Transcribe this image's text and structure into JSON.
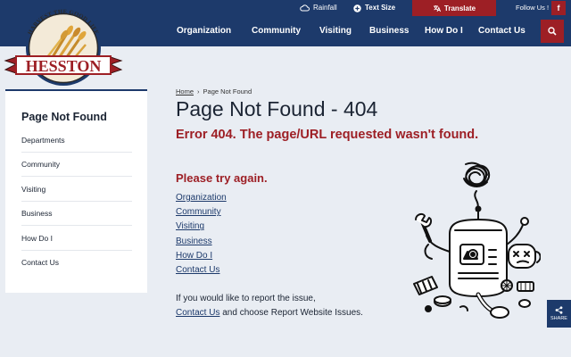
{
  "utility": {
    "rainfall": "Rainfall",
    "text_size": "Text Size",
    "translate": "Translate",
    "follow_us": "Follow Us !",
    "facebook_glyph": "f"
  },
  "logo": {
    "arc_text": "HARVEST THE GOOD LIFE",
    "banner_text": "HESSTON"
  },
  "nav": [
    "Organization",
    "Community",
    "Visiting",
    "Business",
    "How Do I",
    "Contact Us"
  ],
  "sidebar": {
    "title": "Page Not Found",
    "items": [
      "Departments",
      "Community",
      "Visiting",
      "Business",
      "How Do I",
      "Contact Us"
    ]
  },
  "breadcrumb": {
    "home": "Home",
    "separator": "›",
    "current": "Page Not Found"
  },
  "main": {
    "title": "Page Not Found - 404",
    "error": "Error 404. The page/URL requested wasn't found.",
    "try_again": "Please try again.",
    "links": [
      "Organization",
      "Community",
      "Visiting",
      "Business",
      "How Do I",
      "Contact Us"
    ],
    "report_line1": "If you would like to report the issue,",
    "report_link": "Contact Us",
    "report_line2": " and choose Report Website Issues."
  },
  "share": {
    "label": "SHARE"
  },
  "colors": {
    "navy": "#1d3a6b",
    "brand_red": "#9d1f25",
    "page_bg": "#e9edf3"
  }
}
